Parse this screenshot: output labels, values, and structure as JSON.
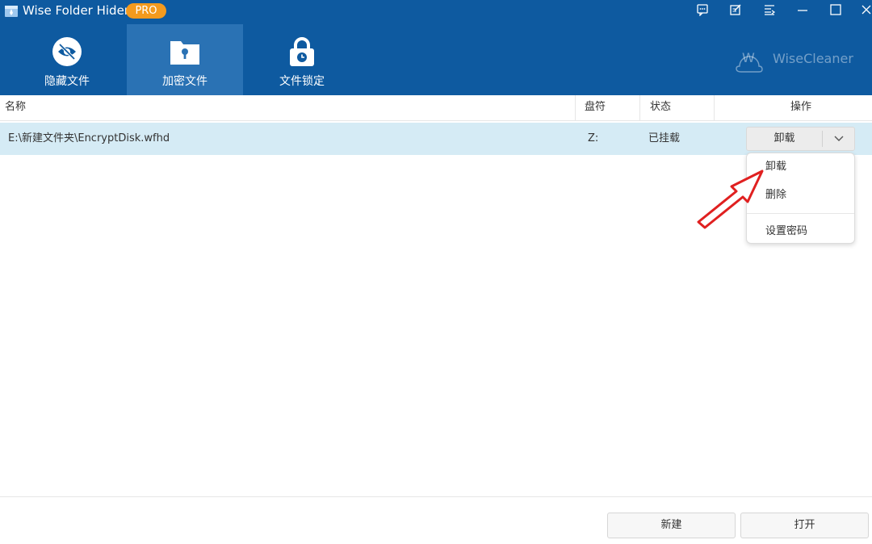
{
  "app": {
    "title": "Wise Folder Hider",
    "badge": "PRO"
  },
  "window_controls": [
    {
      "icon": "feedback-icon"
    },
    {
      "icon": "edit-icon"
    },
    {
      "icon": "menu-icon"
    },
    {
      "icon": "minimize-icon"
    },
    {
      "icon": "maximize-icon"
    },
    {
      "icon": "close-icon"
    }
  ],
  "tabs": [
    {
      "label": "隐藏文件",
      "icon": "eye-slash-icon",
      "active": false
    },
    {
      "label": "加密文件",
      "icon": "encrypted-folder-icon",
      "active": true
    },
    {
      "label": "文件锁定",
      "icon": "lock-icon",
      "active": false
    }
  ],
  "brand": {
    "logo_letter": "W",
    "text": "WiseCleaner"
  },
  "table": {
    "columns": [
      "名称",
      "盘符",
      "状态",
      "操作"
    ],
    "rows": [
      {
        "name": "E:\\新建文件夹\\EncryptDisk.wfhd",
        "drive": "Z:",
        "status": "已挂载",
        "action": "卸载"
      }
    ]
  },
  "dropdown_menu": {
    "items": [
      "卸载",
      "删除",
      "设置密码"
    ]
  },
  "footer": {
    "new_button": "新建",
    "open_button": "打开"
  },
  "colors": {
    "header": "#0e5aa0",
    "active_tab": "#2a72b4",
    "badge": "#f39a1e",
    "row_selected": "#d5ebf5",
    "arrow": "#e02020"
  }
}
